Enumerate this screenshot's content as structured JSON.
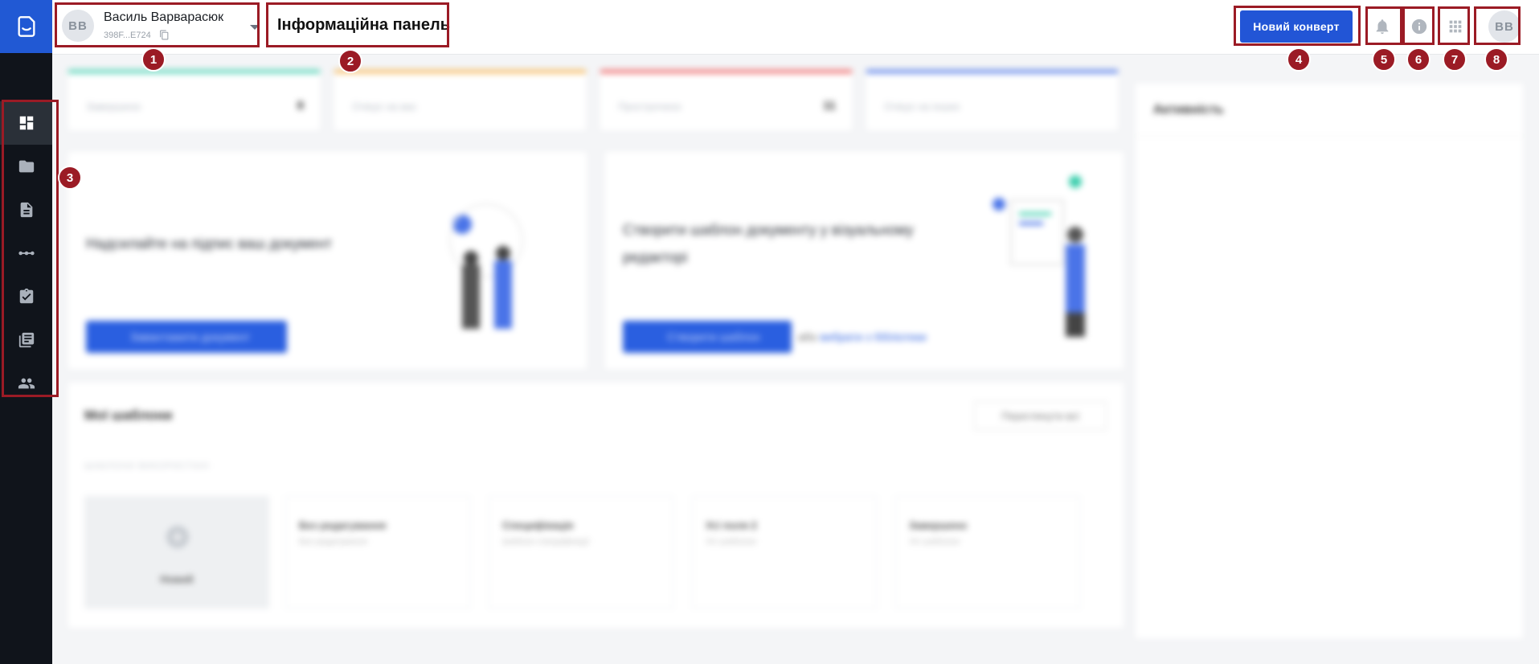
{
  "account": {
    "initials": "ВВ",
    "name": "Василь Варварасюк",
    "id_short": "398F...E724"
  },
  "header": {
    "title": "Інформаційна панель",
    "new_envelope_label": "Новий конверт",
    "user_initials": "ВВ"
  },
  "sidebar": {
    "items": [
      {
        "icon": "dashboard-icon"
      },
      {
        "icon": "folder-icon"
      },
      {
        "icon": "document-icon"
      },
      {
        "icon": "workflow-icon"
      },
      {
        "icon": "assignment-check-icon"
      },
      {
        "icon": "library-icon"
      },
      {
        "icon": "people-icon"
      }
    ]
  },
  "stats": [
    {
      "label": "Завершено",
      "value": "8",
      "color": "#3ecfae"
    },
    {
      "label": "Очікує на вас",
      "value": "",
      "color": "#f7b24a"
    },
    {
      "label": "Прострочено",
      "value": "11",
      "color": "#ef5b5b"
    },
    {
      "label": "Очікує на інших",
      "value": "",
      "color": "#4a74e8"
    }
  ],
  "cards": {
    "sign": {
      "title": "Надсилайте на підпис ваш документ",
      "button": "Завантажити документ"
    },
    "template": {
      "title": "Створити шаблон документу у візуальному редакторі",
      "button": "Створити шаблон",
      "or_text": "або",
      "link": "вибрати з бібліотеки"
    }
  },
  "templates": {
    "title": "Мої шаблони",
    "view_all": "Переглянути всі",
    "subtitle": "ШАБЛОНИ ВИКОРИСТАНІ",
    "new_label": "Новий",
    "items": [
      {
        "name": "Без редагування",
        "sub": "Без редагування"
      },
      {
        "name": "Специфікація",
        "sub": "Шаблон специфікації"
      },
      {
        "name": "Усі поля 2",
        "sub": "Усі шаблони"
      },
      {
        "name": "Завершено",
        "sub": "Усі шаблони"
      }
    ]
  },
  "activity": {
    "title": "Активність"
  },
  "annotations": [
    "1",
    "2",
    "3",
    "4",
    "5",
    "6",
    "7",
    "8"
  ],
  "colors": {
    "accent": "#2255d6",
    "sidebar": "#10141b",
    "annotation": "#9b1b25"
  }
}
